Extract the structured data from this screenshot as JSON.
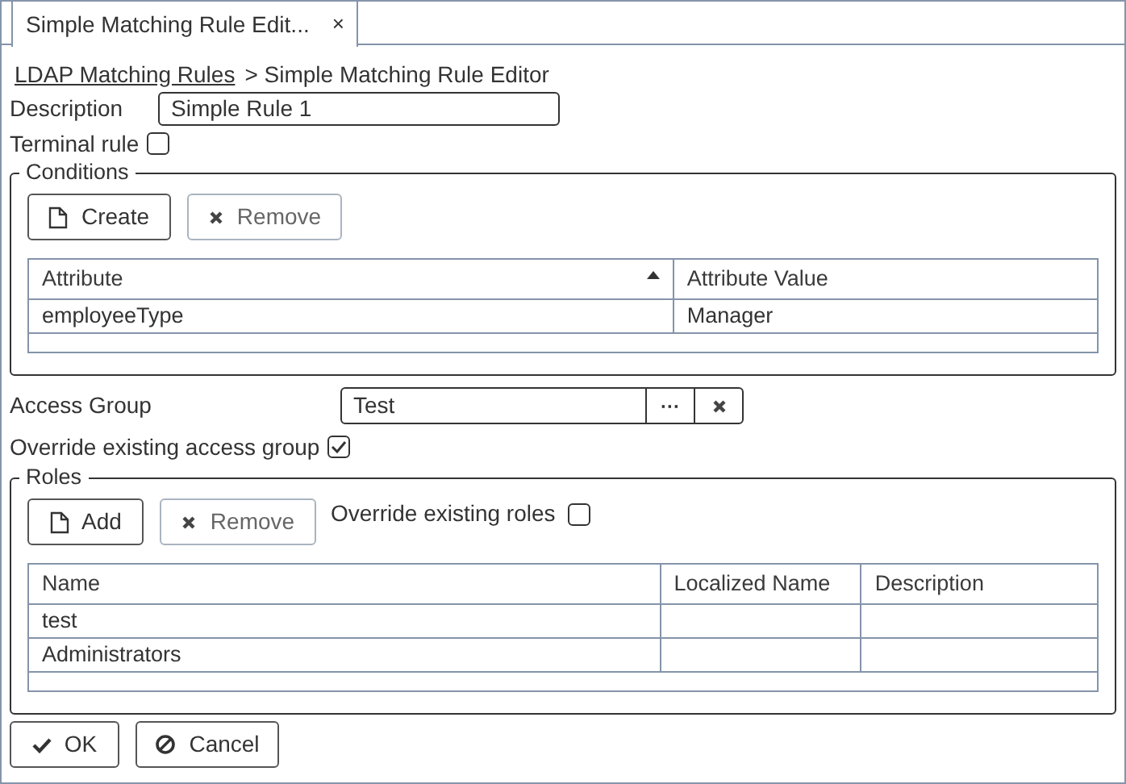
{
  "tabs": [
    {
      "label": "Simple Matching Rule Edit...",
      "close": "×",
      "selected": true
    }
  ],
  "breadcrumb": {
    "link": "LDAP Matching Rules",
    "current": "> Simple Matching Rule Editor"
  },
  "description": {
    "label": "Description",
    "value": "Simple Rule 1"
  },
  "terminal_rule": {
    "label": "Terminal rule",
    "checked": false
  },
  "conditions": {
    "title": "Conditions",
    "buttons": [
      {
        "label": "Create",
        "kind": "new",
        "disabled": false
      },
      {
        "label": "Remove",
        "kind": "remove",
        "disabled": true
      }
    ],
    "table": {
      "columns": [
        {
          "label": "Attribute",
          "sorted": true
        },
        {
          "label": "Attribute Value",
          "sorted": false
        }
      ],
      "rows": [
        [
          "employeeType",
          "Manager"
        ]
      ]
    }
  },
  "access_group": {
    "label": "Access Group",
    "value": "Test",
    "browse": "···"
  },
  "override_access_group": {
    "label": "Override existing access group",
    "checked": true
  },
  "roles": {
    "title": "Roles",
    "buttons": [
      {
        "label": "Add",
        "kind": "new",
        "disabled": false
      },
      {
        "label": "Remove",
        "kind": "remove",
        "disabled": true
      }
    ],
    "override": {
      "label": "Override existing roles",
      "checked": false
    },
    "table": {
      "columns": [
        {
          "label": "Name",
          "sorted": false
        },
        {
          "label": "Localized Name",
          "sorted": false
        },
        {
          "label": "Description",
          "sorted": false
        }
      ],
      "rows": [
        [
          "test"
        ],
        [
          "Administrators"
        ]
      ]
    }
  },
  "footer_buttons": [
    {
      "label": "OK",
      "kind": "ok",
      "disabled": false
    },
    {
      "label": "Cancel",
      "kind": "cancel",
      "disabled": false
    }
  ]
}
